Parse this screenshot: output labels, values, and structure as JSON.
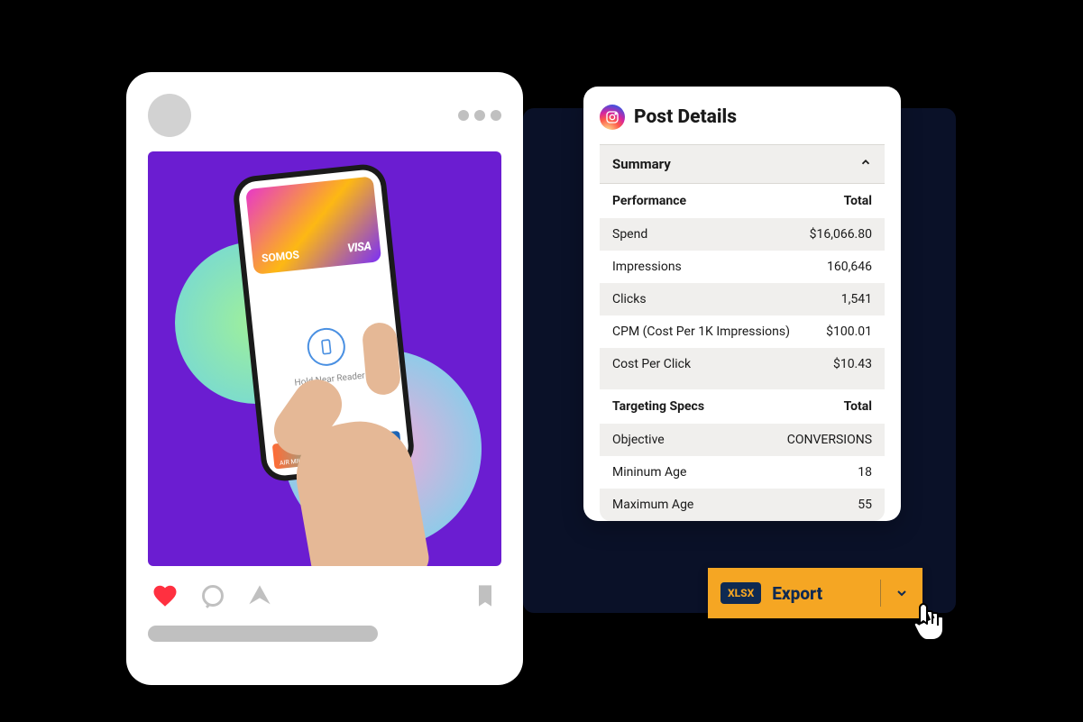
{
  "post_image": {
    "card_brand": "SOMOS",
    "card_network": "VISA",
    "reader_hint": "Hold Near Reader",
    "bottom_card": "AIR MILES"
  },
  "details": {
    "title": "Post Details",
    "summary_label": "Summary",
    "performance": {
      "header_left": "Performance",
      "header_right": "Total",
      "rows": [
        {
          "label": "Spend",
          "value": "$16,066.80"
        },
        {
          "label": "Impressions",
          "value": "160,646"
        },
        {
          "label": "Clicks",
          "value": "1,541"
        },
        {
          "label": "CPM (Cost Per 1K Impressions)",
          "value": "$100.01"
        },
        {
          "label": "Cost Per Click",
          "value": "$10.43"
        }
      ]
    },
    "targeting": {
      "header_left": "Targeting Specs",
      "header_right": "Total",
      "rows": [
        {
          "label": "Objective",
          "value": "CONVERSIONS"
        },
        {
          "label": "Mininum Age",
          "value": "18"
        },
        {
          "label": "Maximum Age",
          "value": "55"
        }
      ]
    }
  },
  "export": {
    "format": "XLSX",
    "label": "Export"
  }
}
